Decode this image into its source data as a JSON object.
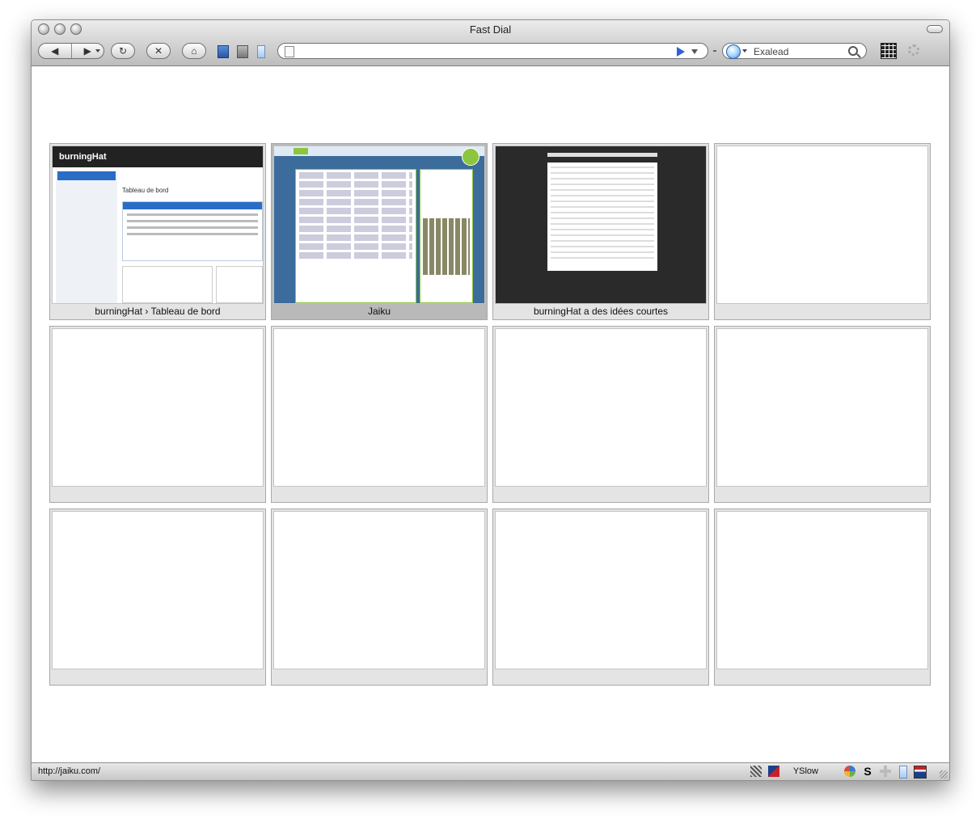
{
  "window": {
    "title": "Fast Dial"
  },
  "toolbar": {
    "url": {
      "value": "",
      "placeholder": ""
    },
    "search": {
      "engine": "Exalead",
      "value": "Exalead"
    }
  },
  "tiles": [
    {
      "label": "burningHat › Tableau de bord",
      "thumb": "wordpress"
    },
    {
      "label": "Jaiku",
      "thumb": "jaiku"
    },
    {
      "label": "burningHat a des idées courtes",
      "thumb": "dark"
    },
    {
      "label": ""
    },
    {
      "label": ""
    },
    {
      "label": ""
    },
    {
      "label": ""
    },
    {
      "label": ""
    },
    {
      "label": ""
    },
    {
      "label": ""
    },
    {
      "label": ""
    },
    {
      "label": ""
    }
  ],
  "thumbs": {
    "wp_brand": "burningHat",
    "wp_title": "Tableau de bord"
  },
  "status": {
    "url": "http://jaiku.com/",
    "yslow": "YSlow"
  },
  "colors": {
    "accent": "#2f62d8",
    "jaiku_green": "#8cc63f",
    "wp_blue": "#2a6dc7"
  }
}
